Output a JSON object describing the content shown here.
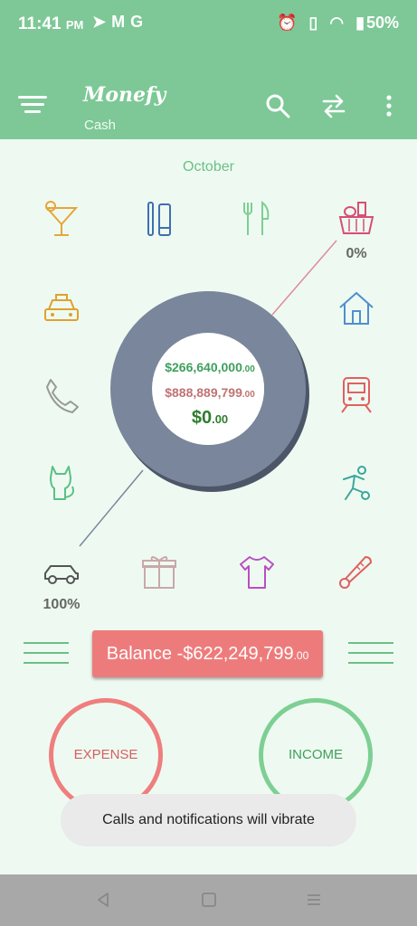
{
  "status": {
    "time": "11:41",
    "ampm": "PM",
    "battery": "50%"
  },
  "app": {
    "title": "Monefy",
    "account": "Cash"
  },
  "month": "October",
  "categories": {
    "food_percent": "0%",
    "car_percent": "100%"
  },
  "summary": {
    "income_main": "$266,640,000",
    "income_cents": ".00",
    "expense_main": "$888,889,799",
    "expense_cents": ".00",
    "net_main": "$0",
    "net_cents": ".00"
  },
  "balance": {
    "label": "Balance -$622,249,799",
    "cents": ".00"
  },
  "buttons": {
    "expense": "EXPENSE",
    "income": "INCOME"
  },
  "toast": "Calls and notifications will vibrate",
  "colors": {
    "primary": "#7dc896",
    "background": "#eefaf1",
    "donut": "#7a869c",
    "expense": "#ee7b7b",
    "income": "#7dcf93"
  }
}
